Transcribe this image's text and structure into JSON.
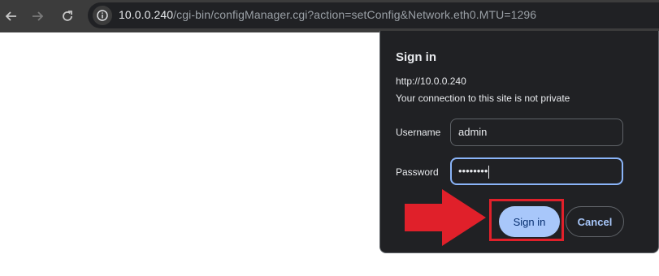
{
  "browser": {
    "back_icon": "arrow-left-icon",
    "forward_icon": "arrow-right-icon",
    "reload_icon": "reload-icon",
    "site_info_icon": "info-icon",
    "url_host": "10.0.0.240",
    "url_path": "/cgi-bin/configManager.cgi?action=setConfig&Network.eth0.MTU=1296"
  },
  "dialog": {
    "title": "Sign in",
    "origin": "http://10.0.0.240",
    "warning": "Your connection to this site is not private",
    "username_label": "Username",
    "username_value": "admin",
    "password_label": "Password",
    "password_value": "••••••••",
    "signin_label": "Sign in",
    "cancel_label": "Cancel"
  },
  "annotation": {
    "highlight_color": "#e0202a",
    "arrow_icon": "red-arrow-pointer"
  }
}
